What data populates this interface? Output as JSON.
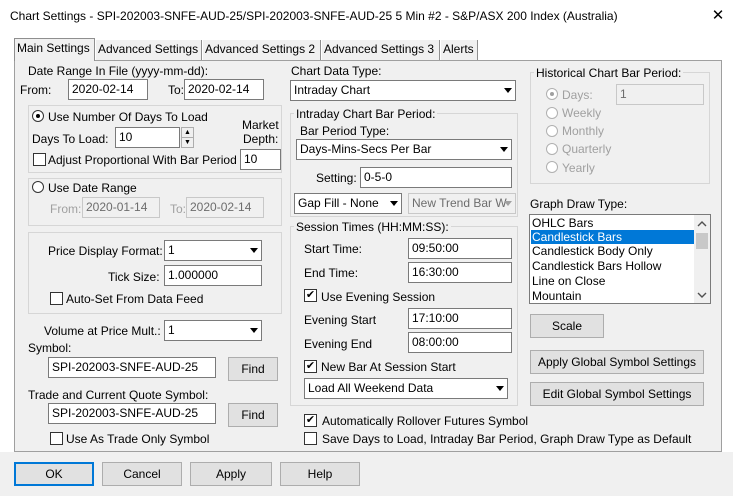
{
  "window": {
    "title": "Chart Settings - SPI-202003-SNFE-AUD-25/SPI-202003-SNFE-AUD-25  5 Min  #2 - S&P/ASX 200 Index (Australia)",
    "close_glyph": "✕"
  },
  "tabs": [
    {
      "label": "Main Settings",
      "active": true
    },
    {
      "label": "Advanced Settings"
    },
    {
      "label": "Advanced Settings 2"
    },
    {
      "label": "Advanced Settings 3"
    },
    {
      "label": "Alerts"
    }
  ],
  "date_range": {
    "label": "Date Range In File (yyyy-mm-dd):",
    "from_label": "From:",
    "from_value": "2020-02-14",
    "to_label": "To:",
    "to_value": "2020-02-14"
  },
  "days_group": {
    "radio_label": "Use Number Of Days To Load",
    "days_label": "Days To Load:",
    "days_value": "10",
    "market_depth_label_1": "Market",
    "market_depth_label_2": "Depth:",
    "market_depth_value": "10",
    "adjust_label": "Adjust Proportional With Bar Period"
  },
  "date_range_group": {
    "radio_label": "Use Date Range",
    "from_label": "From:",
    "from_value": "2020-01-14",
    "to_label": "To:",
    "to_value": "2020-02-14"
  },
  "price_group": {
    "price_format_label": "Price Display Format:",
    "price_format_value": "1",
    "tick_size_label": "Tick Size:",
    "tick_size_value": "1.000000",
    "auto_set_label": "Auto-Set From Data Feed"
  },
  "volume": {
    "label": "Volume at Price Mult.:",
    "value": "1"
  },
  "symbol": {
    "label": "Symbol:",
    "value": "SPI-202003-SNFE-AUD-25",
    "find_label": "Find"
  },
  "trade_symbol": {
    "label": "Trade and Current Quote Symbol:",
    "value": "SPI-202003-SNFE-AUD-25",
    "find_label": "Find",
    "trade_only_label": "Use As Trade Only Symbol"
  },
  "chart_data_type": {
    "label": "Chart Data Type:",
    "value": "Intraday Chart"
  },
  "intraday_period": {
    "group_label": "Intraday Chart Bar Period:",
    "bar_period_type_label": "Bar Period Type:",
    "bar_period_type_value": "Days-Mins-Secs Per Bar",
    "setting_label": "Setting:",
    "setting_value": "0-5-0",
    "gap_fill_value": "Gap Fill - None",
    "new_trend_value": "New Trend Bar W"
  },
  "session": {
    "group_label": "Session Times (HH:MM:SS):",
    "start_label": "Start Time:",
    "start_value": "09:50:00",
    "end_label": "End Time:",
    "end_value": "16:30:00",
    "use_evening_label": "Use Evening Session",
    "evening_start_label": "Evening Start",
    "evening_start_value": "17:10:00",
    "evening_end_label": "Evening End",
    "evening_end_value": "08:00:00",
    "new_bar_label": "New Bar At Session Start",
    "weekend_value": "Load All Weekend Data"
  },
  "historical": {
    "group_label": "Historical Chart Bar Period:",
    "days_label": "Days:",
    "days_value": "1",
    "weekly_label": "Weekly",
    "monthly_label": "Monthly",
    "quarterly_label": "Quarterly",
    "yearly_label": "Yearly"
  },
  "graph_draw": {
    "label": "Graph Draw Type:",
    "items": [
      "OHLC Bars",
      "Candlestick Bars",
      "Candlestick Body Only",
      "Candlestick Bars Hollow",
      "Line on Close",
      "Mountain"
    ],
    "selected": "Candlestick Bars",
    "scale_label": "Scale"
  },
  "global_buttons": {
    "apply_label": "Apply Global Symbol Settings",
    "edit_label": "Edit Global Symbol Settings"
  },
  "bottom_checks": {
    "rollover_label": "Automatically Rollover Futures Symbol",
    "save_default_label": "Save Days to Load, Intraday Bar Period, Graph Draw Type as Default"
  },
  "footer": {
    "ok_label": "OK",
    "cancel_label": "Cancel",
    "apply_label": "Apply",
    "help_label": "Help"
  },
  "check_glyph": "✔"
}
